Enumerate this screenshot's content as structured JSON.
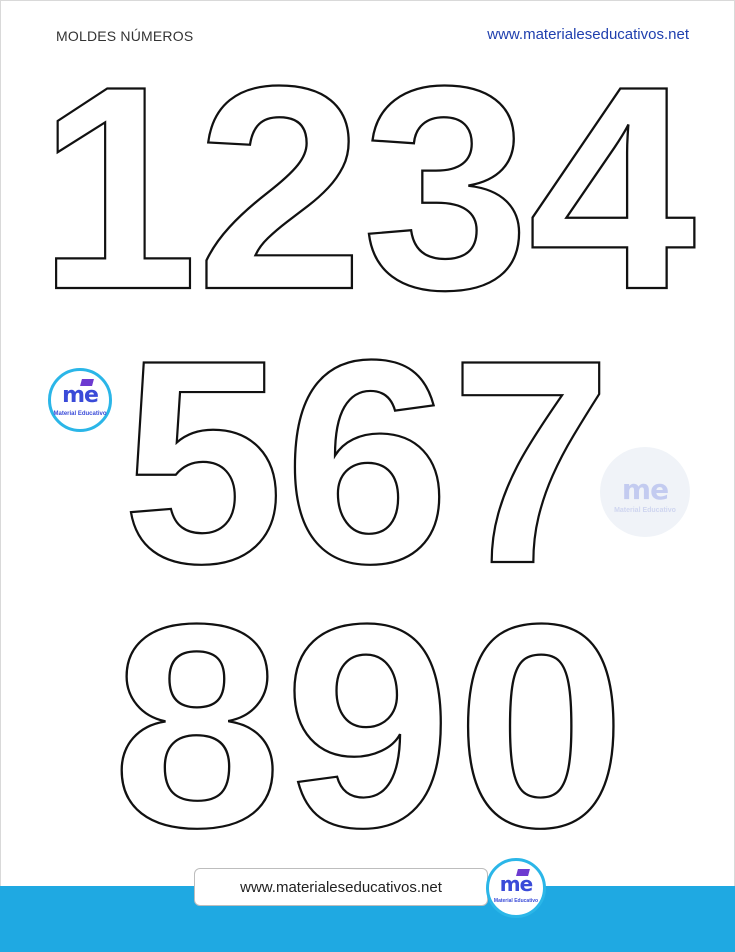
{
  "header": {
    "title": "MOLDES NÚMEROS",
    "url": "www.materialeseducativos.net"
  },
  "digits": {
    "row1": [
      "1",
      "2",
      "3",
      "4"
    ],
    "row2": [
      "5",
      "6",
      "7"
    ],
    "row3": [
      "8",
      "9",
      "0"
    ]
  },
  "logo": {
    "mark": "me",
    "caption": "Material Educativo"
  },
  "footer": {
    "url": "www.materialeseducativos.net"
  },
  "colors": {
    "accent_blue": "#1fa9e2",
    "link_blue": "#1f3fae",
    "logo_purple": "#6d3ad0"
  }
}
